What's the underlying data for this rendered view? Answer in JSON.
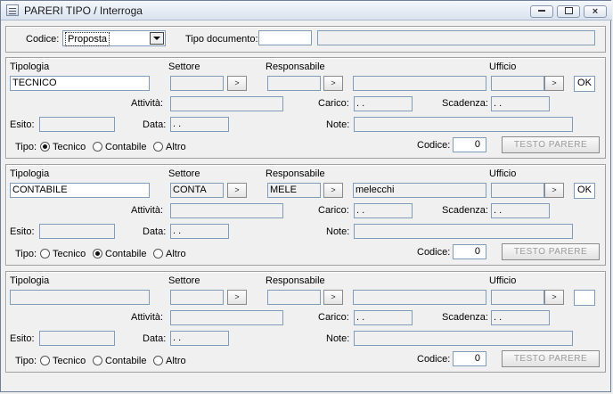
{
  "window": {
    "title": "PARERI TIPO / Interroga",
    "minimize_icon": "minimize-icon",
    "restore_icon": "restore-icon",
    "close_icon": "close-icon"
  },
  "header": {
    "codice_label": "Codice:",
    "codice_value": "Proposta",
    "tipo_documento_label": "Tipo documento:",
    "tipo_documento_value": "",
    "tipo_documento_desc": ""
  },
  "labels": {
    "tipologia": "Tipologia",
    "settore": "Settore",
    "responsabile": "Responsabile",
    "ufficio": "Ufficio",
    "attivita": "Attività:",
    "carico": "Carico:",
    "scadenza": "Scadenza:",
    "esito": "Esito:",
    "data": "Data:",
    "note": "Note:",
    "tipo": "Tipo:",
    "tecnico": "Tecnico",
    "contabile": "Contabile",
    "altro": "Altro",
    "codice": "Codice:",
    "pick_button": ">",
    "testo_parere": "TESTO PARERE"
  },
  "sections": [
    {
      "tipologia": "TECNICO",
      "settore": "",
      "responsabile": "",
      "responsabile_name": "",
      "ufficio": "",
      "ok": "OK",
      "attivita": "",
      "carico": " .  .",
      "scadenza": " .  .",
      "esito": "",
      "data": " .  .",
      "note": "",
      "tipo_selected": "Tecnico",
      "codice": "0"
    },
    {
      "tipologia": "CONTABILE",
      "settore": "CONTA",
      "responsabile": "MELE",
      "responsabile_name": "melecchi",
      "ufficio": "",
      "ok": "OK",
      "attivita": "",
      "carico": " .  .",
      "scadenza": " .  .",
      "esito": "",
      "data": " .  .",
      "note": "",
      "tipo_selected": "Contabile",
      "codice": "0"
    },
    {
      "tipologia": "",
      "settore": "",
      "responsabile": "",
      "responsabile_name": "",
      "ufficio": "",
      "ok": "",
      "attivita": "",
      "carico": " .  .",
      "scadenza": " .  .",
      "esito": "",
      "data": " .  .",
      "note": "",
      "tipo_selected": "",
      "codice": "0"
    }
  ]
}
